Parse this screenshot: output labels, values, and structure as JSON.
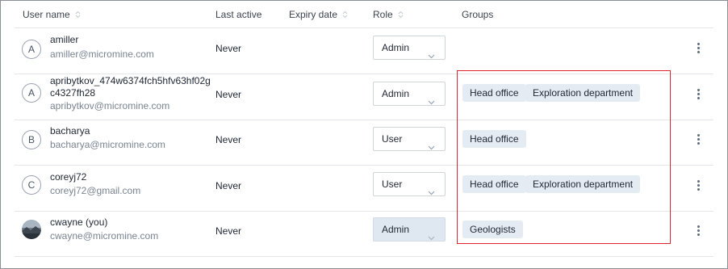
{
  "columns": {
    "user_name": "User name",
    "last_active": "Last active",
    "expiry_date": "Expiry date",
    "role": "Role",
    "groups": "Groups"
  },
  "users": [
    {
      "avatar_letter": "A",
      "name": "amiller",
      "email": "amiller@micromine.com",
      "last_active": "Never",
      "role": "Admin",
      "groups": []
    },
    {
      "avatar_letter": "A",
      "name_line1": "apribytkov_474w6374fch5hfv63hf02g",
      "name_line2": "c4327fh28",
      "email": "apribytkov@micromine.com",
      "last_active": "Never",
      "role": "Admin",
      "groups": [
        "Head office",
        "Exploration department"
      ]
    },
    {
      "avatar_letter": "B",
      "name": "bacharya",
      "email": "bacharya@micromine.com",
      "last_active": "Never",
      "role": "User",
      "groups": [
        "Head office"
      ]
    },
    {
      "avatar_letter": "C",
      "name": "coreyj72",
      "email": "coreyj72@gmail.com",
      "last_active": "Never",
      "role": "User",
      "groups": [
        "Head office",
        "Exploration department"
      ]
    },
    {
      "avatar_letter": "",
      "name": "cwayne (you)",
      "email": "cwayne@micromine.com",
      "last_active": "Never",
      "role": "Admin",
      "groups": [
        "Geologists"
      ]
    }
  ],
  "icons": {
    "sort": "sort-icon",
    "chevron": "chevron-down-icon",
    "kebab": "more-vertical-icon"
  },
  "colors": {
    "tag_bg": "#e5ebf2",
    "highlight": "#e0242e",
    "disabled_select": "#dfe7f1"
  }
}
